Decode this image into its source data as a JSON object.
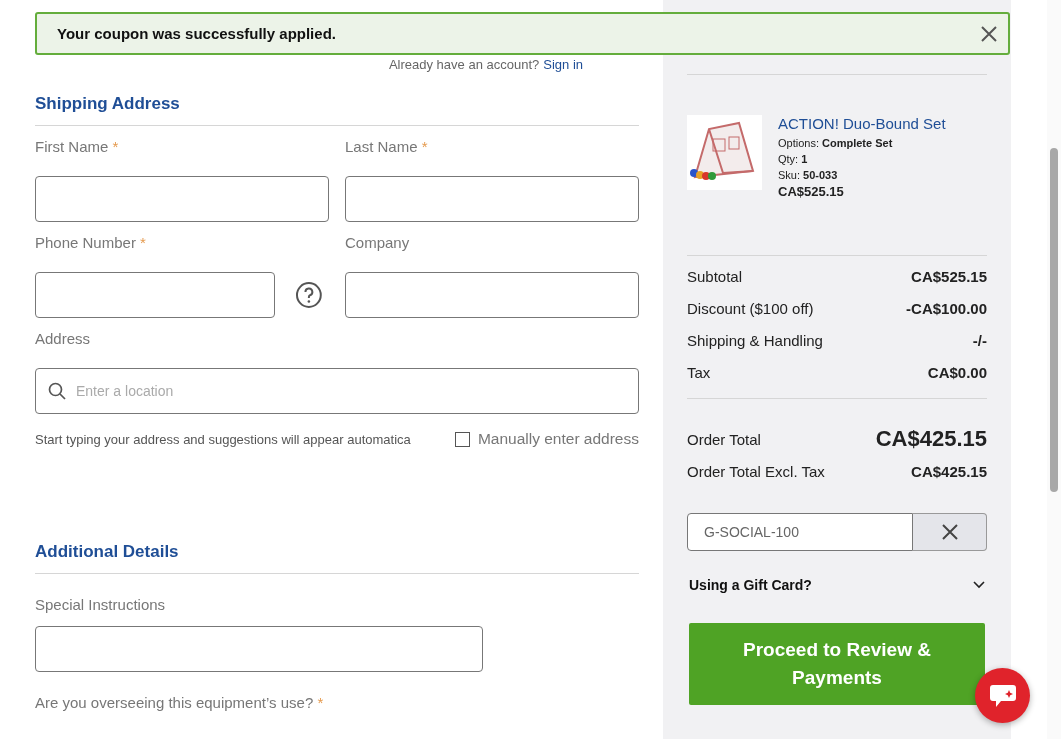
{
  "notification": {
    "text": "Your coupon was successfully applied.",
    "dismissible": true
  },
  "account_prompt": {
    "text": "Already have an account?",
    "link": "Sign in"
  },
  "shipping": {
    "title": "Shipping Address",
    "rows": [
      [
        {
          "label": "First Name",
          "required_mark": "*",
          "kind": "text"
        },
        {
          "label": "Last Name",
          "required_mark": "*",
          "kind": "text"
        }
      ],
      [
        {
          "label": "Phone Number",
          "required_mark": "*",
          "kind": "phone"
        },
        {
          "label": "Company",
          "kind": "text"
        }
      ],
      [
        {
          "label": "Address",
          "kind": "search",
          "placeholder": "Enter a location"
        }
      ]
    ],
    "hint": "Start typing your address and suggestions will appear automatica",
    "manual": {
      "label": "Manually enter address",
      "checked": false
    }
  },
  "additional": {
    "title": "Additional Details",
    "fields": [
      {
        "label": "Special Instructions",
        "kind": "text"
      }
    ],
    "question": {
      "label": "Are you overseeing this equipment’s use?",
      "required_mark": "*"
    }
  },
  "summary": {
    "item": {
      "kind": "picture",
      "name": "ACTION! Duo-Bound Set",
      "details": [
        "Options: **Complete Set**",
        "Qty: **1**",
        "Sku: **50-033**"
      ],
      "price": "CA$525.15"
    },
    "totals": [
      {
        "label": "Subtotal",
        "value": "CA$525.15"
      },
      {
        "label": "Discount ($100 off)",
        "value": "-CA$100.00"
      },
      {
        "label": "Shipping & Handling",
        "value": "-/-"
      },
      {
        "label": "Tax",
        "value": "CA$0.00"
      }
    ],
    "order_total": {
      "label": "Order Total",
      "value": "CA$425.15"
    },
    "excl_tax": {
      "label": "Order Total Excl. Tax",
      "value": "CA$425.15"
    },
    "coupon": {
      "value": "G-SOCIAL-100"
    },
    "gift_card": {
      "label": "Using a Gift Card?",
      "expanded": false
    },
    "proceed_button": "Proceed to Review & Payments"
  }
}
